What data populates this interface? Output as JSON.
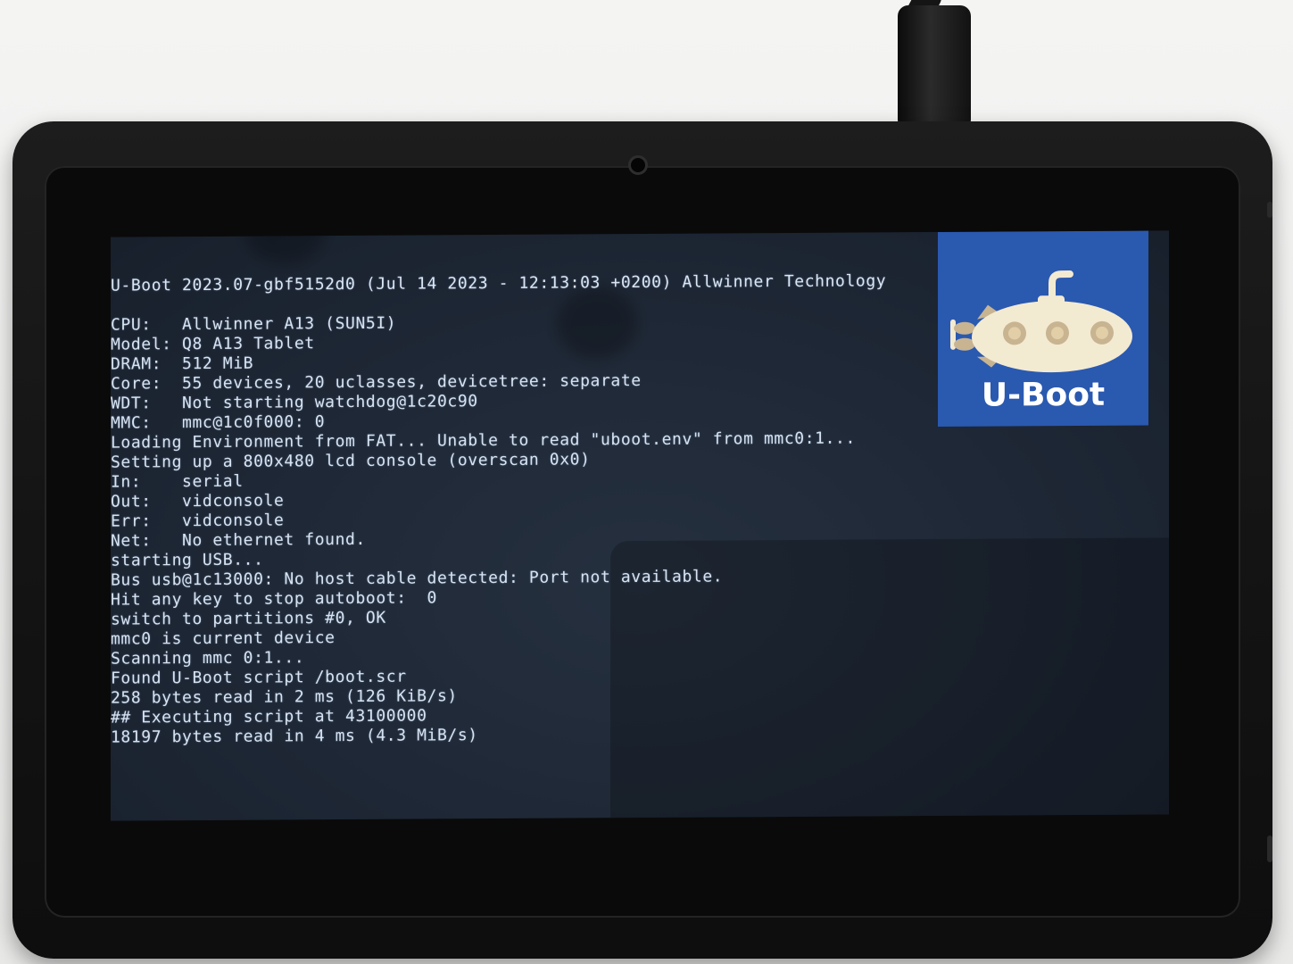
{
  "screen": {
    "lines": [
      "U-Boot 2023.07-gbf5152d0 (Jul 14 2023 - 12:13:03 +0200) Allwinner Technology",
      "",
      "CPU:   Allwinner A13 (SUN5I)",
      "Model: Q8 A13 Tablet",
      "DRAM:  512 MiB",
      "Core:  55 devices, 20 uclasses, devicetree: separate",
      "WDT:   Not starting watchdog@1c20c90",
      "MMC:   mmc@1c0f000: 0",
      "Loading Environment from FAT... Unable to read \"uboot.env\" from mmc0:1...",
      "Setting up a 800x480 lcd console (overscan 0x0)",
      "In:    serial",
      "Out:   vidconsole",
      "Err:   vidconsole",
      "Net:   No ethernet found.",
      "starting USB...",
      "Bus usb@1c13000: No host cable detected: Port not available.",
      "Hit any key to stop autoboot:  0",
      "switch to partitions #0, OK",
      "mmc0 is current device",
      "Scanning mmc 0:1...",
      "Found U-Boot script /boot.scr",
      "258 bytes read in 2 ms (126 KiB/s)",
      "## Executing script at 43100000",
      "18197 bytes read in 4 ms (4.3 MiB/s)"
    ],
    "logo_text": "U-Boot",
    "colors": {
      "console_text": "#d7e3f0",
      "console_bg": "#1e2735",
      "logo_bg": "#2a59b0"
    }
  }
}
